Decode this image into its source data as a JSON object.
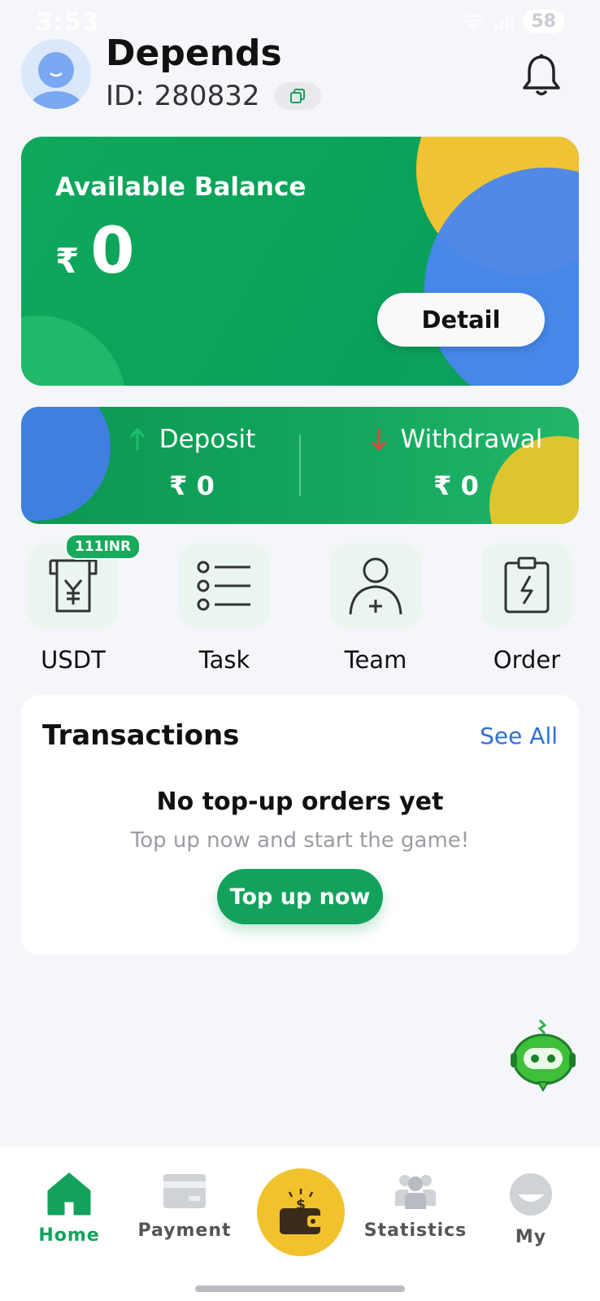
{
  "status_bar": {
    "time": "3:53",
    "battery": "58"
  },
  "user": {
    "name": "Depends",
    "id_label": "ID:",
    "id_value": "280832"
  },
  "balance": {
    "label": "Available Balance",
    "currency": "₹",
    "value": "0",
    "detail_label": "Detail"
  },
  "flow": {
    "deposit": {
      "label": "Deposit",
      "currency": "₹",
      "value": "0"
    },
    "withdrawal": {
      "label": "Withdrawal",
      "currency": "₹",
      "value": "0"
    }
  },
  "quick_actions": [
    {
      "label": "USDT",
      "icon": "usdt-yen-receipt-icon",
      "badge": "111INR"
    },
    {
      "label": "Task",
      "icon": "task-list-icon"
    },
    {
      "label": "Team",
      "icon": "team-add-user-icon"
    },
    {
      "label": "Order",
      "icon": "order-clipboard-icon"
    }
  ],
  "transactions": {
    "title": "Transactions",
    "see_all": "See All",
    "empty_title": "No top-up orders yet",
    "empty_sub": "Top up now and start the game!",
    "cta": "Top up now"
  },
  "nav": {
    "home": "Home",
    "payment": "Payment",
    "statistics": "Statistics",
    "my": "My"
  },
  "colors": {
    "brand_green": "#13a25c",
    "accent_yellow": "#f2c22d",
    "accent_blue": "#4a86f0",
    "link_blue": "#2f6fd6"
  }
}
